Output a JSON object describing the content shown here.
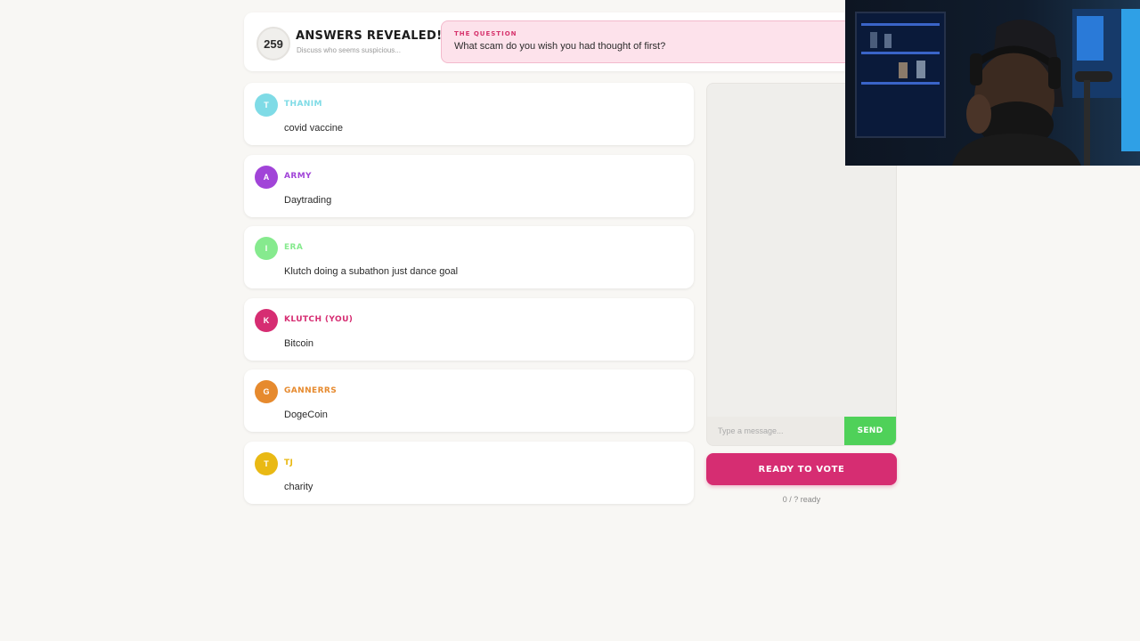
{
  "header": {
    "timer": "259",
    "phase_title": "ANSWERS REVEALED!",
    "phase_subtitle": "Discuss who seems suspicious...",
    "question_label": "THE QUESTION",
    "question_text": "What scam do you wish you had thought of first?"
  },
  "answers": [
    {
      "initial": "T",
      "name": "THANIM",
      "answer": "covid vaccine",
      "color": "#7fdbe6"
    },
    {
      "initial": "A",
      "name": "ARMY",
      "answer": "Daytrading",
      "color": "#a144d8"
    },
    {
      "initial": "I",
      "name": "ERA",
      "answer": "Klutch doing a subathon just dance goal",
      "color": "#86ea8e"
    },
    {
      "initial": "K",
      "name": "KLUTCH (YOU)",
      "answer": "Bitcoin",
      "color": "#d62d72"
    },
    {
      "initial": "G",
      "name": "GANNERRS",
      "answer": "DogeCoin",
      "color": "#e68a2e"
    },
    {
      "initial": "T",
      "name": "TJ",
      "answer": "charity",
      "color": "#e9b914"
    }
  ],
  "chat": {
    "placeholder": "Type a message...",
    "send_label": "SEND"
  },
  "ready": {
    "button_label": "READY TO VOTE",
    "status": "0 / ? ready"
  },
  "colors": {
    "accent": "#d62d72",
    "send": "#4fd159",
    "background": "#f8f7f4"
  }
}
